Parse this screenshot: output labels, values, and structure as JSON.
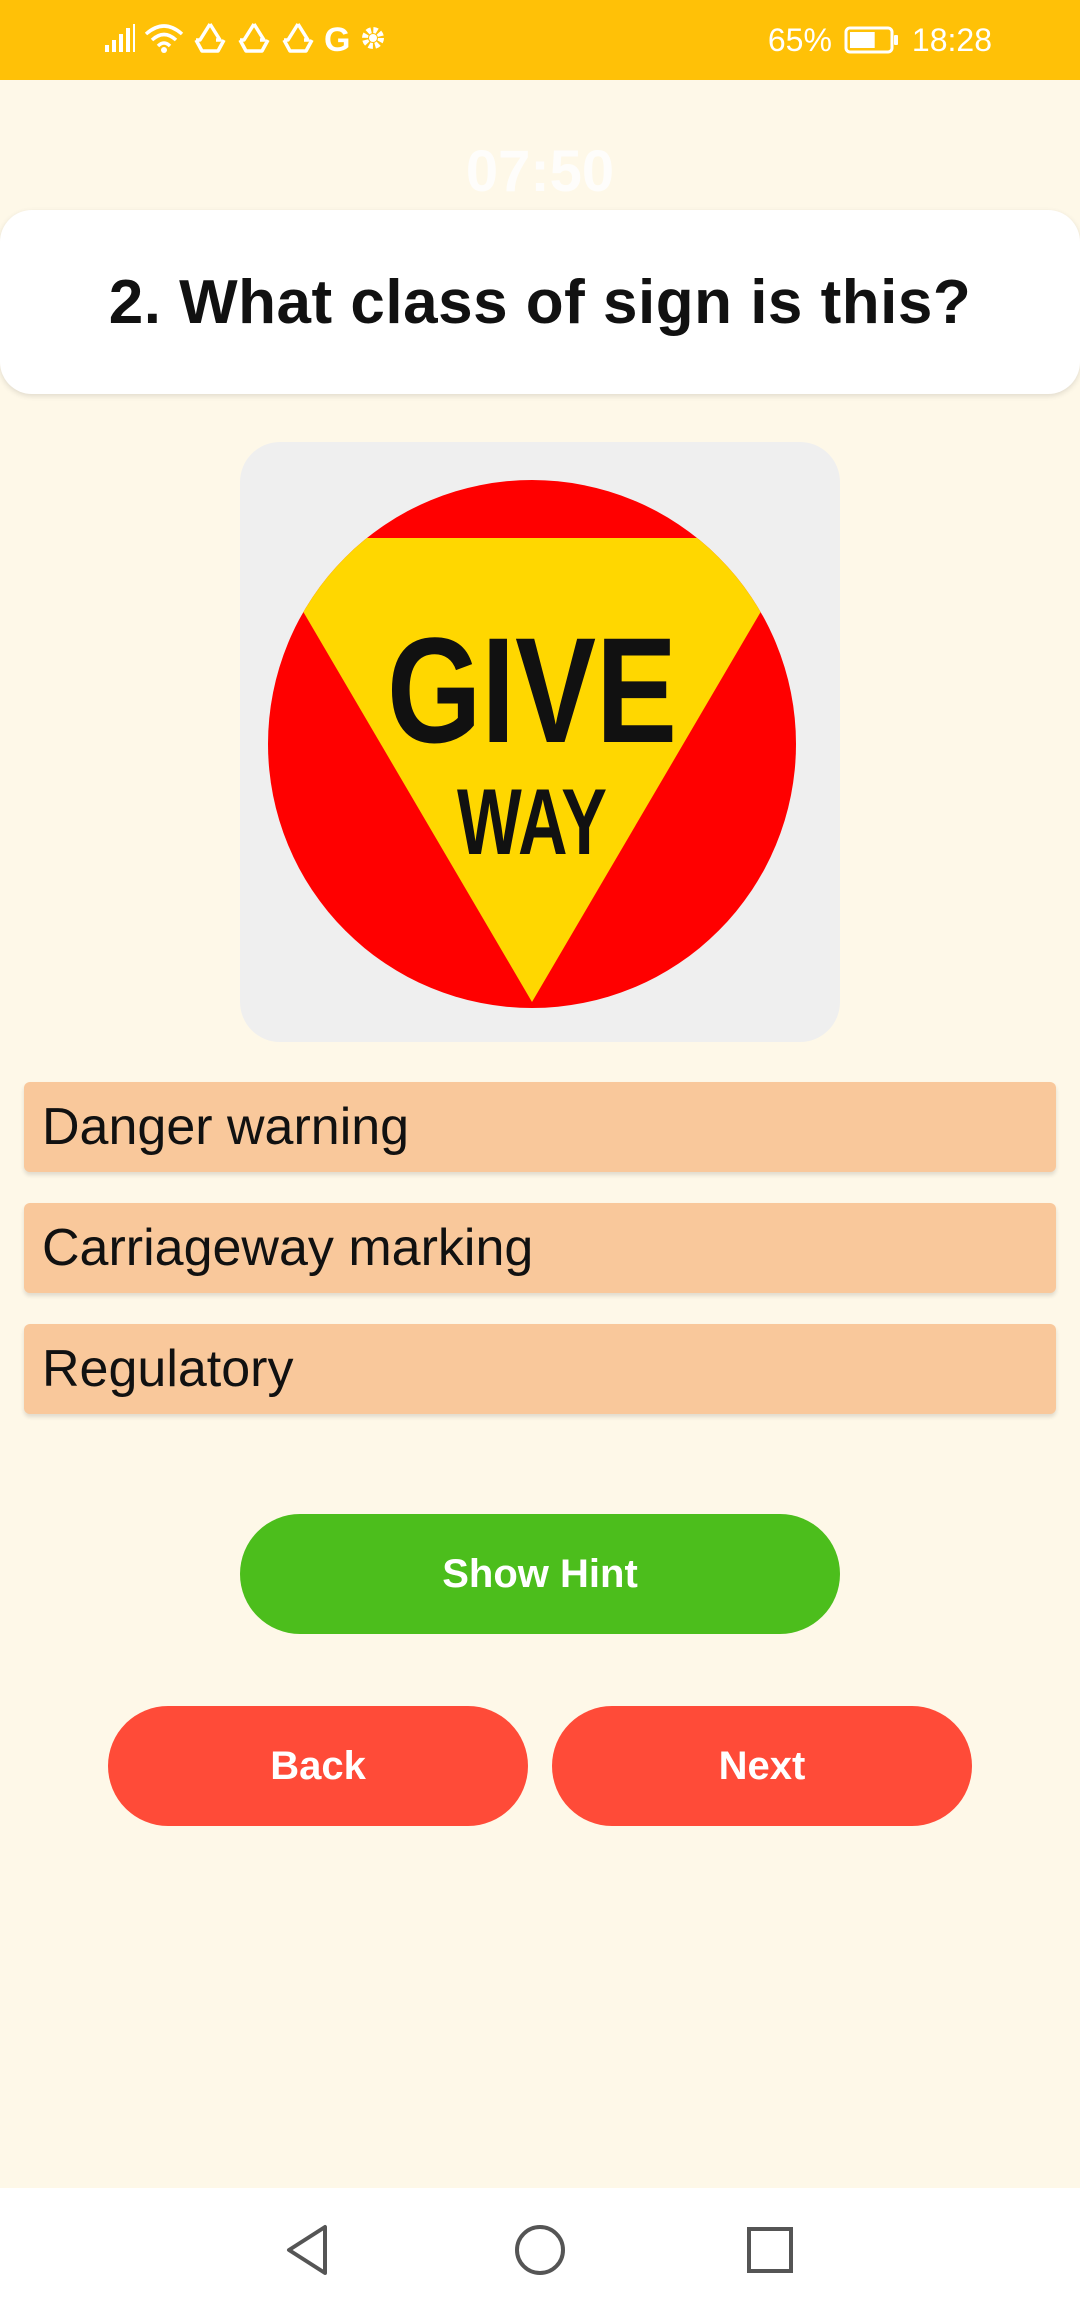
{
  "status_bar": {
    "network_label": "G",
    "battery_percent": "65%",
    "battery_level": 0.65,
    "time": "18:28",
    "background_color": "#FFC107",
    "icons": [
      "signal-icon",
      "wifi-icon",
      "recycle-icon",
      "recycle-icon",
      "recycle-icon",
      "gear-icon",
      "battery-icon"
    ]
  },
  "quiz": {
    "timer": "07:50",
    "question": "2. What class of sign is this?",
    "sign": {
      "line1": "GIVE",
      "line2": "WAY",
      "colors": {
        "circle": "#FF0000",
        "triangle": "#FFD700",
        "text": "#111111",
        "box": "#EFEFEF"
      }
    },
    "options": [
      {
        "label": "Danger warning"
      },
      {
        "label": "Carriageway marking"
      },
      {
        "label": "Regulatory"
      }
    ],
    "option_color": "#F9C89B"
  },
  "buttons": {
    "hint": "Show Hint",
    "back": "Back",
    "next": "Next",
    "hint_color": "#4CBE1C",
    "nav_color": "#FF4B38"
  },
  "nav_bar": {
    "icons": [
      "back-triangle-icon",
      "home-circle-icon",
      "recents-square-icon"
    ]
  }
}
